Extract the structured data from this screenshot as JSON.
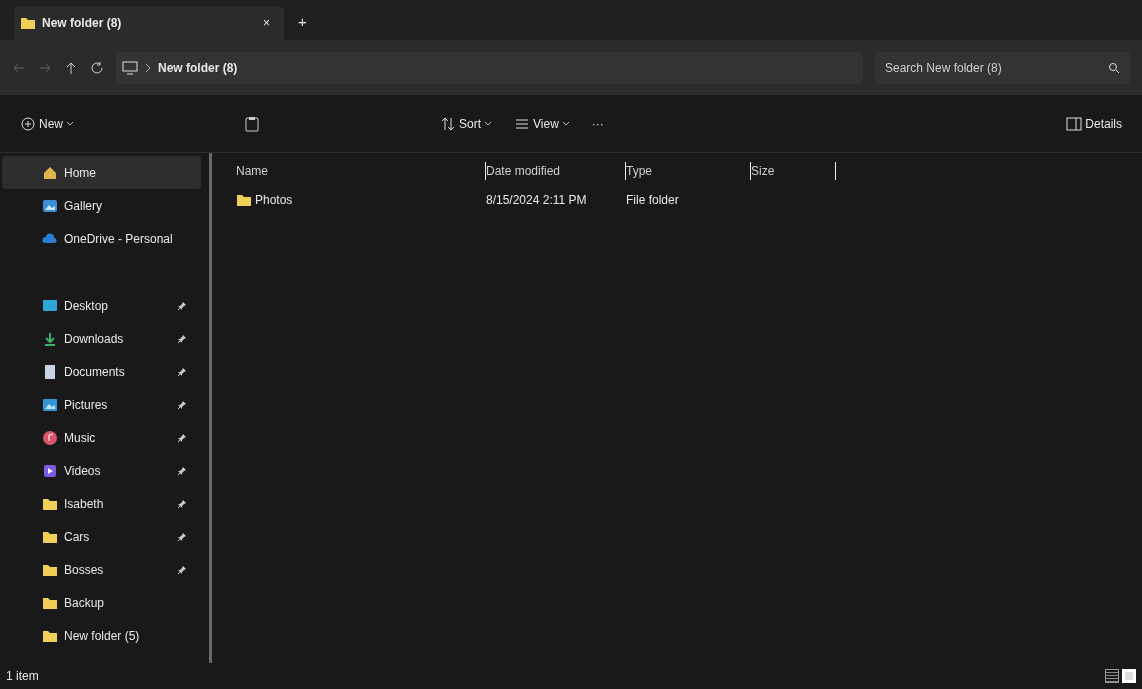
{
  "tab": {
    "title": "New folder (8)",
    "close": "×",
    "add": "+"
  },
  "address": {
    "path": "New folder (8)",
    "search_placeholder": "Search New folder (8)"
  },
  "commands": [
    {
      "label": "New",
      "kind": "new"
    },
    {
      "label": "Sort",
      "kind": "sort"
    },
    {
      "label": "View",
      "kind": "view"
    },
    {
      "label": "···",
      "kind": "more"
    }
  ],
  "details_label": "Details",
  "sidebar": {
    "sections": [
      {
        "items": [
          {
            "label": "Home",
            "kind": "home",
            "selected": true,
            "pinned": false
          },
          {
            "label": "Gallery",
            "kind": "gallery",
            "selected": false,
            "pinned": false
          },
          {
            "label": "OneDrive - Personal",
            "kind": "cloud",
            "selected": false,
            "pinned": false
          }
        ]
      },
      {
        "items": [
          {
            "label": "Desktop",
            "kind": "desktop",
            "selected": false,
            "pinned": true
          },
          {
            "label": "Downloads",
            "kind": "download",
            "selected": false,
            "pinned": true
          },
          {
            "label": "Documents",
            "kind": "document",
            "selected": false,
            "pinned": true
          },
          {
            "label": "Pictures",
            "kind": "picture",
            "selected": false,
            "pinned": true
          },
          {
            "label": "Music",
            "kind": "music",
            "selected": false,
            "pinned": true
          },
          {
            "label": "Videos",
            "kind": "video",
            "selected": false,
            "pinned": true
          },
          {
            "label": "Isabeth",
            "kind": "folder",
            "selected": false,
            "pinned": true
          },
          {
            "label": "Cars",
            "kind": "folder",
            "selected": false,
            "pinned": true
          },
          {
            "label": "Bosses",
            "kind": "folder",
            "selected": false,
            "pinned": true
          },
          {
            "label": "Backup",
            "kind": "folder",
            "selected": false,
            "pinned": false
          },
          {
            "label": "New folder (5)",
            "kind": "folder",
            "selected": false,
            "pinned": false
          }
        ]
      }
    ]
  },
  "table": {
    "columns": [
      "Name",
      "Date modified",
      "Type",
      "Size"
    ],
    "rows": [
      {
        "name": "Photos",
        "date": "8/15/2024 2:11 PM",
        "type": "File folder",
        "size": ""
      }
    ]
  },
  "status_bar": {
    "text": "1 item",
    "views": [
      {
        "kind": "details",
        "selected": false
      },
      {
        "kind": "tiles",
        "selected": true
      }
    ]
  }
}
